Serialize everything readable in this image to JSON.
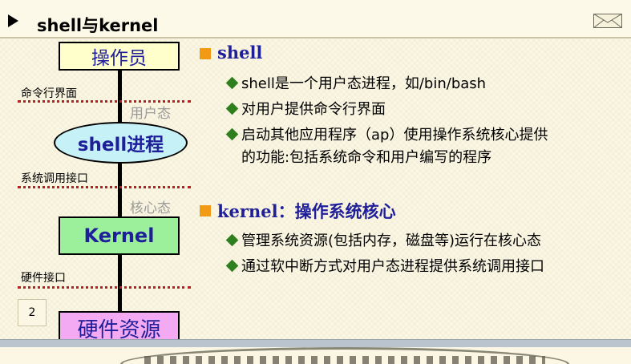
{
  "title": "shell与kernel",
  "page_number": "2",
  "diagram": {
    "operator": "操作员",
    "cmd_interface": "命令行界面",
    "user_mode": "用户态",
    "shell_process": "shell进程",
    "syscall_interface": "系统调用接口",
    "kernel_mode": "核心态",
    "kernel": "Kernel",
    "hw_interface": "硬件接口",
    "hardware": "硬件资源"
  },
  "sections": [
    {
      "heading_en": "shell",
      "heading_cn": "",
      "bullets": [
        "shell是一个用户态进程，如/bin/bash",
        "对用户提供命令行界面",
        "启动其他应用程序（ap）使用操作系统核心提供",
        "的功能:包括系统命令和用户编写的程序"
      ]
    },
    {
      "heading_en": "kernel：",
      "heading_cn": "操作系统核心",
      "bullets": [
        "管理系统资源(包括内存，磁盘等)运行在核心态",
        "通过软中断方式对用户态进程提供系统调用接口"
      ]
    }
  ],
  "colors": {
    "heading": "#1f1f9a",
    "bullet": "#2f7f1f",
    "square": "#f29a14",
    "dotted_line": "#b22222"
  }
}
